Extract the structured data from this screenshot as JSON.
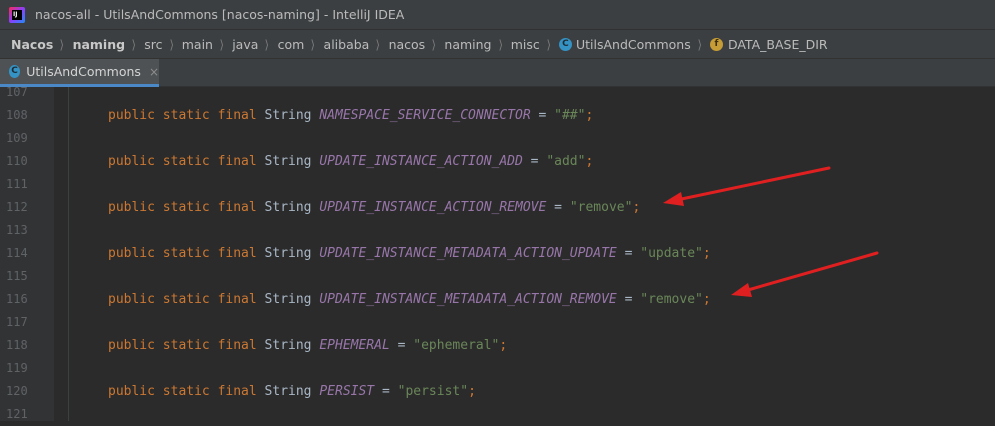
{
  "window": {
    "title": "nacos-all - UtilsAndCommons [nacos-naming] - IntelliJ IDEA",
    "app_icon_glyph": "IJ"
  },
  "breadcrumb": [
    {
      "label": "Nacos",
      "bold": true
    },
    {
      "label": "naming",
      "bold": true
    },
    {
      "label": "src"
    },
    {
      "label": "main"
    },
    {
      "label": "java"
    },
    {
      "label": "com"
    },
    {
      "label": "alibaba"
    },
    {
      "label": "nacos"
    },
    {
      "label": "naming"
    },
    {
      "label": "misc"
    },
    {
      "label": "UtilsAndCommons",
      "icon": "class-icon",
      "icon_glyph": "C"
    },
    {
      "label": "DATA_BASE_DIR",
      "icon": "field-icon",
      "icon_glyph": "f"
    }
  ],
  "tabs": [
    {
      "label": "UtilsAndCommons",
      "icon_glyph": "C",
      "close": "×",
      "active": true
    }
  ],
  "editor": {
    "lines": [
      {
        "num": "107",
        "code": null
      },
      {
        "num": "108",
        "code": {
          "mods": "public static final",
          "type": "String",
          "name": "NAMESPACE_SERVICE_CONNECTOR",
          "value": "\"##\""
        }
      },
      {
        "num": "109",
        "code": null
      },
      {
        "num": "110",
        "code": {
          "mods": "public static final",
          "type": "String",
          "name": "UPDATE_INSTANCE_ACTION_ADD",
          "value": "\"add\""
        }
      },
      {
        "num": "111",
        "code": null
      },
      {
        "num": "112",
        "code": {
          "mods": "public static final",
          "type": "String",
          "name": "UPDATE_INSTANCE_ACTION_REMOVE",
          "value": "\"remove\""
        }
      },
      {
        "num": "113",
        "code": null
      },
      {
        "num": "114",
        "code": {
          "mods": "public static final",
          "type": "String",
          "name": "UPDATE_INSTANCE_METADATA_ACTION_UPDATE",
          "value": "\"update\""
        }
      },
      {
        "num": "115",
        "code": null
      },
      {
        "num": "116",
        "code": {
          "mods": "public static final",
          "type": "String",
          "name": "UPDATE_INSTANCE_METADATA_ACTION_REMOVE",
          "value": "\"remove\""
        }
      },
      {
        "num": "117",
        "code": null
      },
      {
        "num": "118",
        "code": {
          "mods": "public static final",
          "type": "String",
          "name": "EPHEMERAL",
          "value": "\"ephemeral\""
        }
      },
      {
        "num": "119",
        "code": null
      },
      {
        "num": "120",
        "code": {
          "mods": "public static final",
          "type": "String",
          "name": "PERSIST",
          "value": "\"persist\""
        }
      },
      {
        "num": "121",
        "code": null
      }
    ],
    "operator": "=",
    "terminator": ";"
  },
  "annotation_color": "#e02020"
}
